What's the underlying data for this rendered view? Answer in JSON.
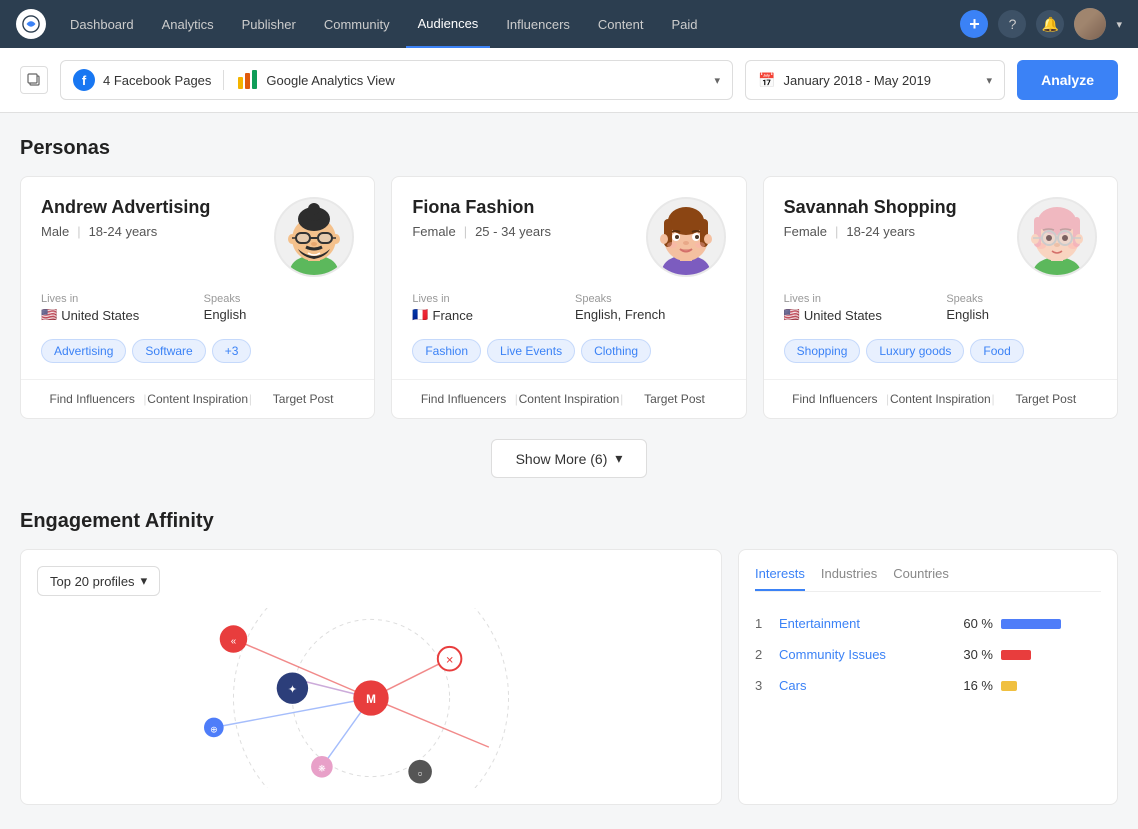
{
  "nav": {
    "items": [
      {
        "label": "Dashboard",
        "active": false
      },
      {
        "label": "Analytics",
        "active": false
      },
      {
        "label": "Publisher",
        "active": false
      },
      {
        "label": "Community",
        "active": false
      },
      {
        "label": "Audiences",
        "active": true
      },
      {
        "label": "Influencers",
        "active": false
      },
      {
        "label": "Content",
        "active": false
      },
      {
        "label": "Paid",
        "active": false
      }
    ]
  },
  "toolbar": {
    "copy_title": "Copy",
    "fb_label": "4 Facebook Pages",
    "ga_label": "Google Analytics View",
    "date_label": "January 2018 - May 2019",
    "analyze_label": "Analyze"
  },
  "personas_section": {
    "title": "Personas",
    "cards": [
      {
        "name": "Andrew Advertising",
        "gender": "Male",
        "age": "18-24 years",
        "lives_in_label": "Lives in",
        "lives_in_value": "United States",
        "speaks_label": "Speaks",
        "speaks_value": "English",
        "flag": "🇺🇸",
        "tags": [
          "Advertising",
          "Software",
          "+3"
        ],
        "actions": [
          "Find Influencers",
          "Content Inspiration",
          "Target Post"
        ]
      },
      {
        "name": "Fiona Fashion",
        "gender": "Female",
        "age": "25 - 34 years",
        "lives_in_label": "Lives in",
        "lives_in_value": "France",
        "speaks_label": "Speaks",
        "speaks_value": "English, French",
        "flag": "🇫🇷",
        "tags": [
          "Fashion",
          "Live Events",
          "Clothing"
        ],
        "actions": [
          "Find Influencers",
          "Content Inspiration",
          "Target Post"
        ]
      },
      {
        "name": "Savannah Shopping",
        "gender": "Female",
        "age": "18-24 years",
        "lives_in_label": "Lives in",
        "lives_in_value": "United States",
        "speaks_label": "Speaks",
        "speaks_value": "English",
        "flag": "🇺🇸",
        "tags": [
          "Shopping",
          "Luxury goods",
          "Food"
        ],
        "actions": [
          "Find Influencers",
          "Content Inspiration",
          "Target Post"
        ]
      }
    ],
    "show_more_label": "Show More (6)"
  },
  "engagement_section": {
    "title": "Engagement Affinity",
    "dropdown_label": "Top 20 profiles",
    "tabs": [
      "Interests",
      "Industries",
      "Countries"
    ],
    "active_tab": "Interests",
    "interests": [
      {
        "rank": 1,
        "name": "Entertainment",
        "pct": "60 %",
        "pct_val": 60,
        "color": "#4e7df9"
      },
      {
        "rank": 2,
        "name": "Community Issues",
        "pct": "30 %",
        "pct_val": 30,
        "color": "#e83d3d"
      },
      {
        "rank": 3,
        "name": "Cars",
        "pct": "16 %",
        "pct_val": 16,
        "color": "#f0c040"
      }
    ]
  }
}
